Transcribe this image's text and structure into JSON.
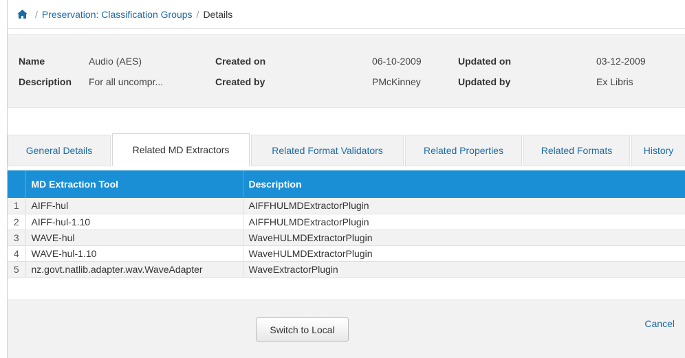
{
  "breadcrumb": {
    "home_icon": "home-icon",
    "link": "Preservation: Classification Groups",
    "current": "Details"
  },
  "details": {
    "name_label": "Name",
    "name_value": "Audio (AES)",
    "description_label": "Description",
    "description_value": "For all uncompr...",
    "created_on_label": "Created on",
    "created_on_value": "06-10-2009",
    "created_by_label": "Created by",
    "created_by_value": "PMcKinney",
    "updated_on_label": "Updated on",
    "updated_on_value": "03-12-2009",
    "updated_by_label": "Updated by",
    "updated_by_value": "Ex Libris"
  },
  "tabs": [
    {
      "label": "General Details",
      "active": false
    },
    {
      "label": "Related MD Extractors",
      "active": true
    },
    {
      "label": "Related Format Validators",
      "active": false
    },
    {
      "label": "Related Properties",
      "active": false
    },
    {
      "label": "Related Formats",
      "active": false
    },
    {
      "label": "History",
      "active": false
    }
  ],
  "table": {
    "columns": [
      "MD Extraction Tool",
      "Description"
    ],
    "rows": [
      {
        "num": "1",
        "tool": "AIFF-hul",
        "description": "AIFFHULMDExtractorPlugin"
      },
      {
        "num": "2",
        "tool": "AIFF-hul-1.10",
        "description": "AIFFHULMDExtractorPlugin"
      },
      {
        "num": "3",
        "tool": "WAVE-hul",
        "description": "WaveHULMDExtractorPlugin"
      },
      {
        "num": "4",
        "tool": "WAVE-hul-1.10",
        "description": "WaveHULMDExtractorPlugin"
      },
      {
        "num": "5",
        "tool": "nz.govt.natlib.adapter.wav.WaveAdapter",
        "description": "WaveExtractorPlugin"
      }
    ]
  },
  "footer": {
    "switch_label": "Switch to Local",
    "cancel_label": "Cancel"
  },
  "colors": {
    "accent": "#1a8fd6",
    "link": "#1a6aa8",
    "panel": "#f2f2f2"
  }
}
